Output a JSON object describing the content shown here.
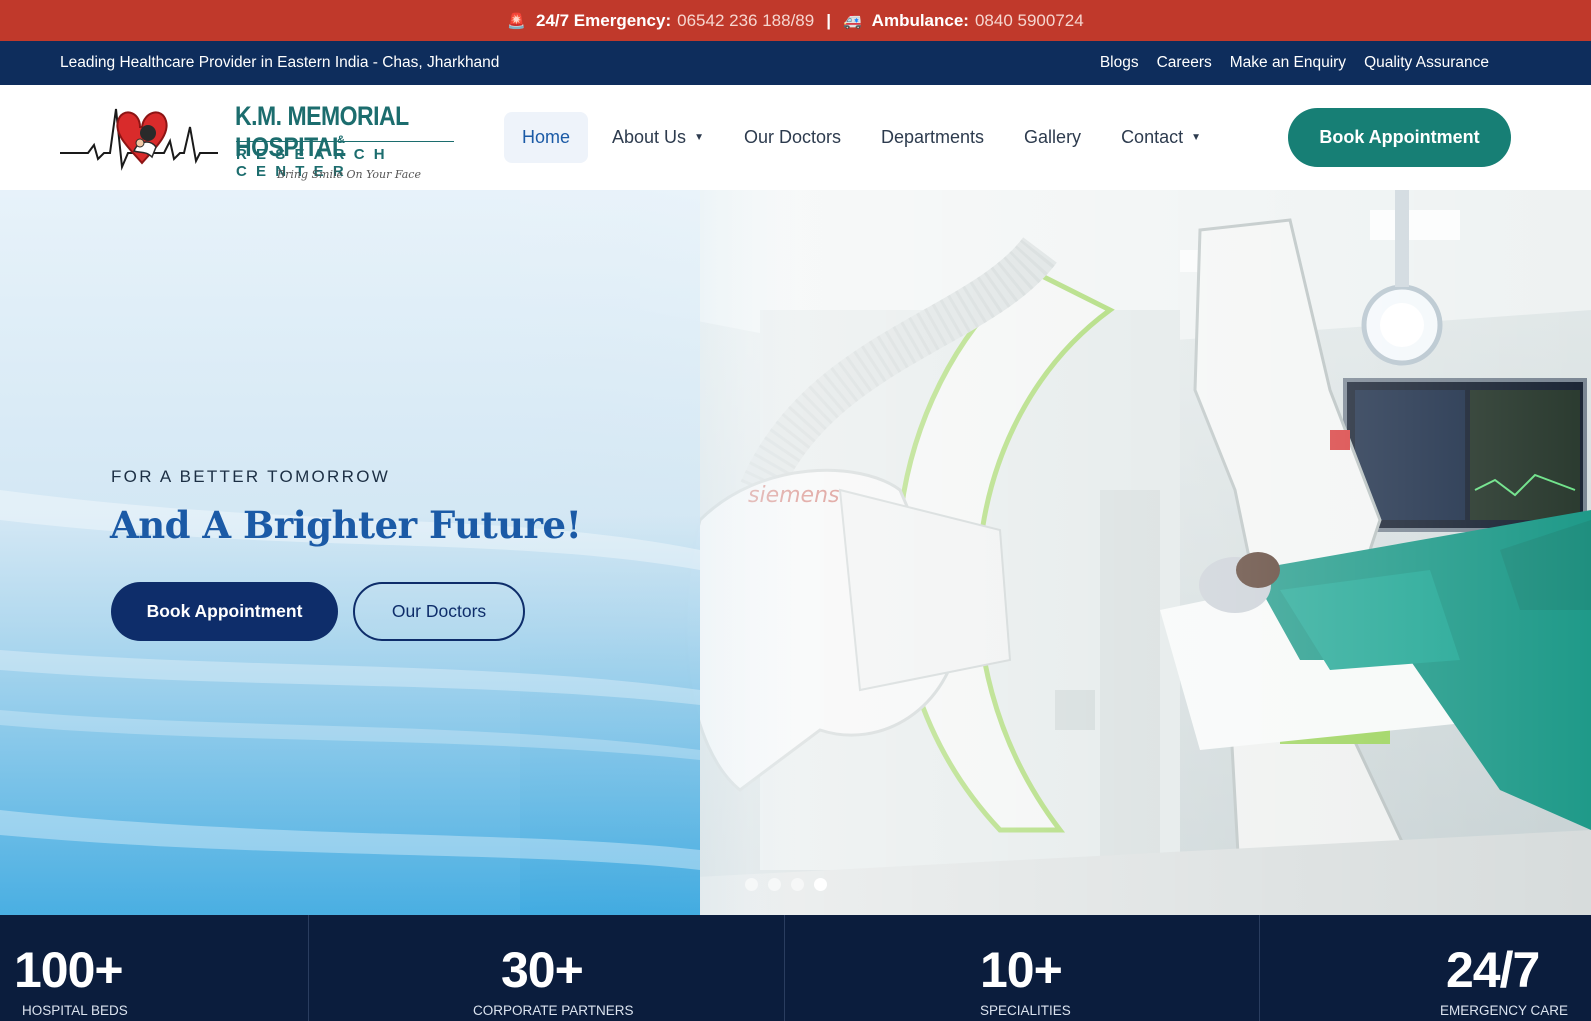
{
  "emergency": {
    "label": "24/7 Emergency:",
    "number": "06542 236 188/89",
    "separator": "|",
    "ambulance_label": "Ambulance:",
    "ambulance_number": "0840 5900724"
  },
  "info_bar": {
    "tagline": "Leading Healthcare Provider in Eastern India - Chas, Jharkhand",
    "links": [
      "Blogs",
      "Careers",
      "Make an Enquiry",
      "Quality Assurance"
    ]
  },
  "logo": {
    "title": "K.M. MEMORIAL HOSPITAL",
    "amp": "&",
    "subtitle": "RESEARCH CENTER",
    "tagline": "Bring Smile On Your Face"
  },
  "nav": {
    "items": [
      {
        "label": "Home",
        "active": true,
        "dropdown": false
      },
      {
        "label": "About Us",
        "active": false,
        "dropdown": true
      },
      {
        "label": "Our Doctors",
        "active": false,
        "dropdown": false
      },
      {
        "label": "Departments",
        "active": false,
        "dropdown": false
      },
      {
        "label": "Gallery",
        "active": false,
        "dropdown": false
      },
      {
        "label": "Contact",
        "active": false,
        "dropdown": true
      }
    ],
    "cta": "Book Appointment"
  },
  "hero": {
    "eyebrow": "FOR A BETTER TOMORROW",
    "title": "And A Brighter Future!",
    "primary_button": "Book Appointment",
    "secondary_button": "Our Doctors",
    "slides_total": 4,
    "active_slide": 4
  },
  "stats": [
    {
      "value": "100+",
      "label": "HOSPITAL BEDS"
    },
    {
      "value": "30+",
      "label": "CORPORATE PARTNERS"
    },
    {
      "value": "10+",
      "label": "SPECIALITIES"
    },
    {
      "value": "24/7",
      "label": "EMERGENCY CARE"
    }
  ],
  "colors": {
    "emergency_bar": "#c0392b",
    "info_bar": "#0e2d5c",
    "brand_teal": "#177f75",
    "hero_title": "#1b5aa6",
    "primary_button": "#0e2d6a",
    "stats_bg": "#0b1d3d"
  },
  "icons": [
    "siren-icon",
    "ambulance-icon",
    "heart-ecg-logo-icon",
    "caret-down-icon"
  ]
}
